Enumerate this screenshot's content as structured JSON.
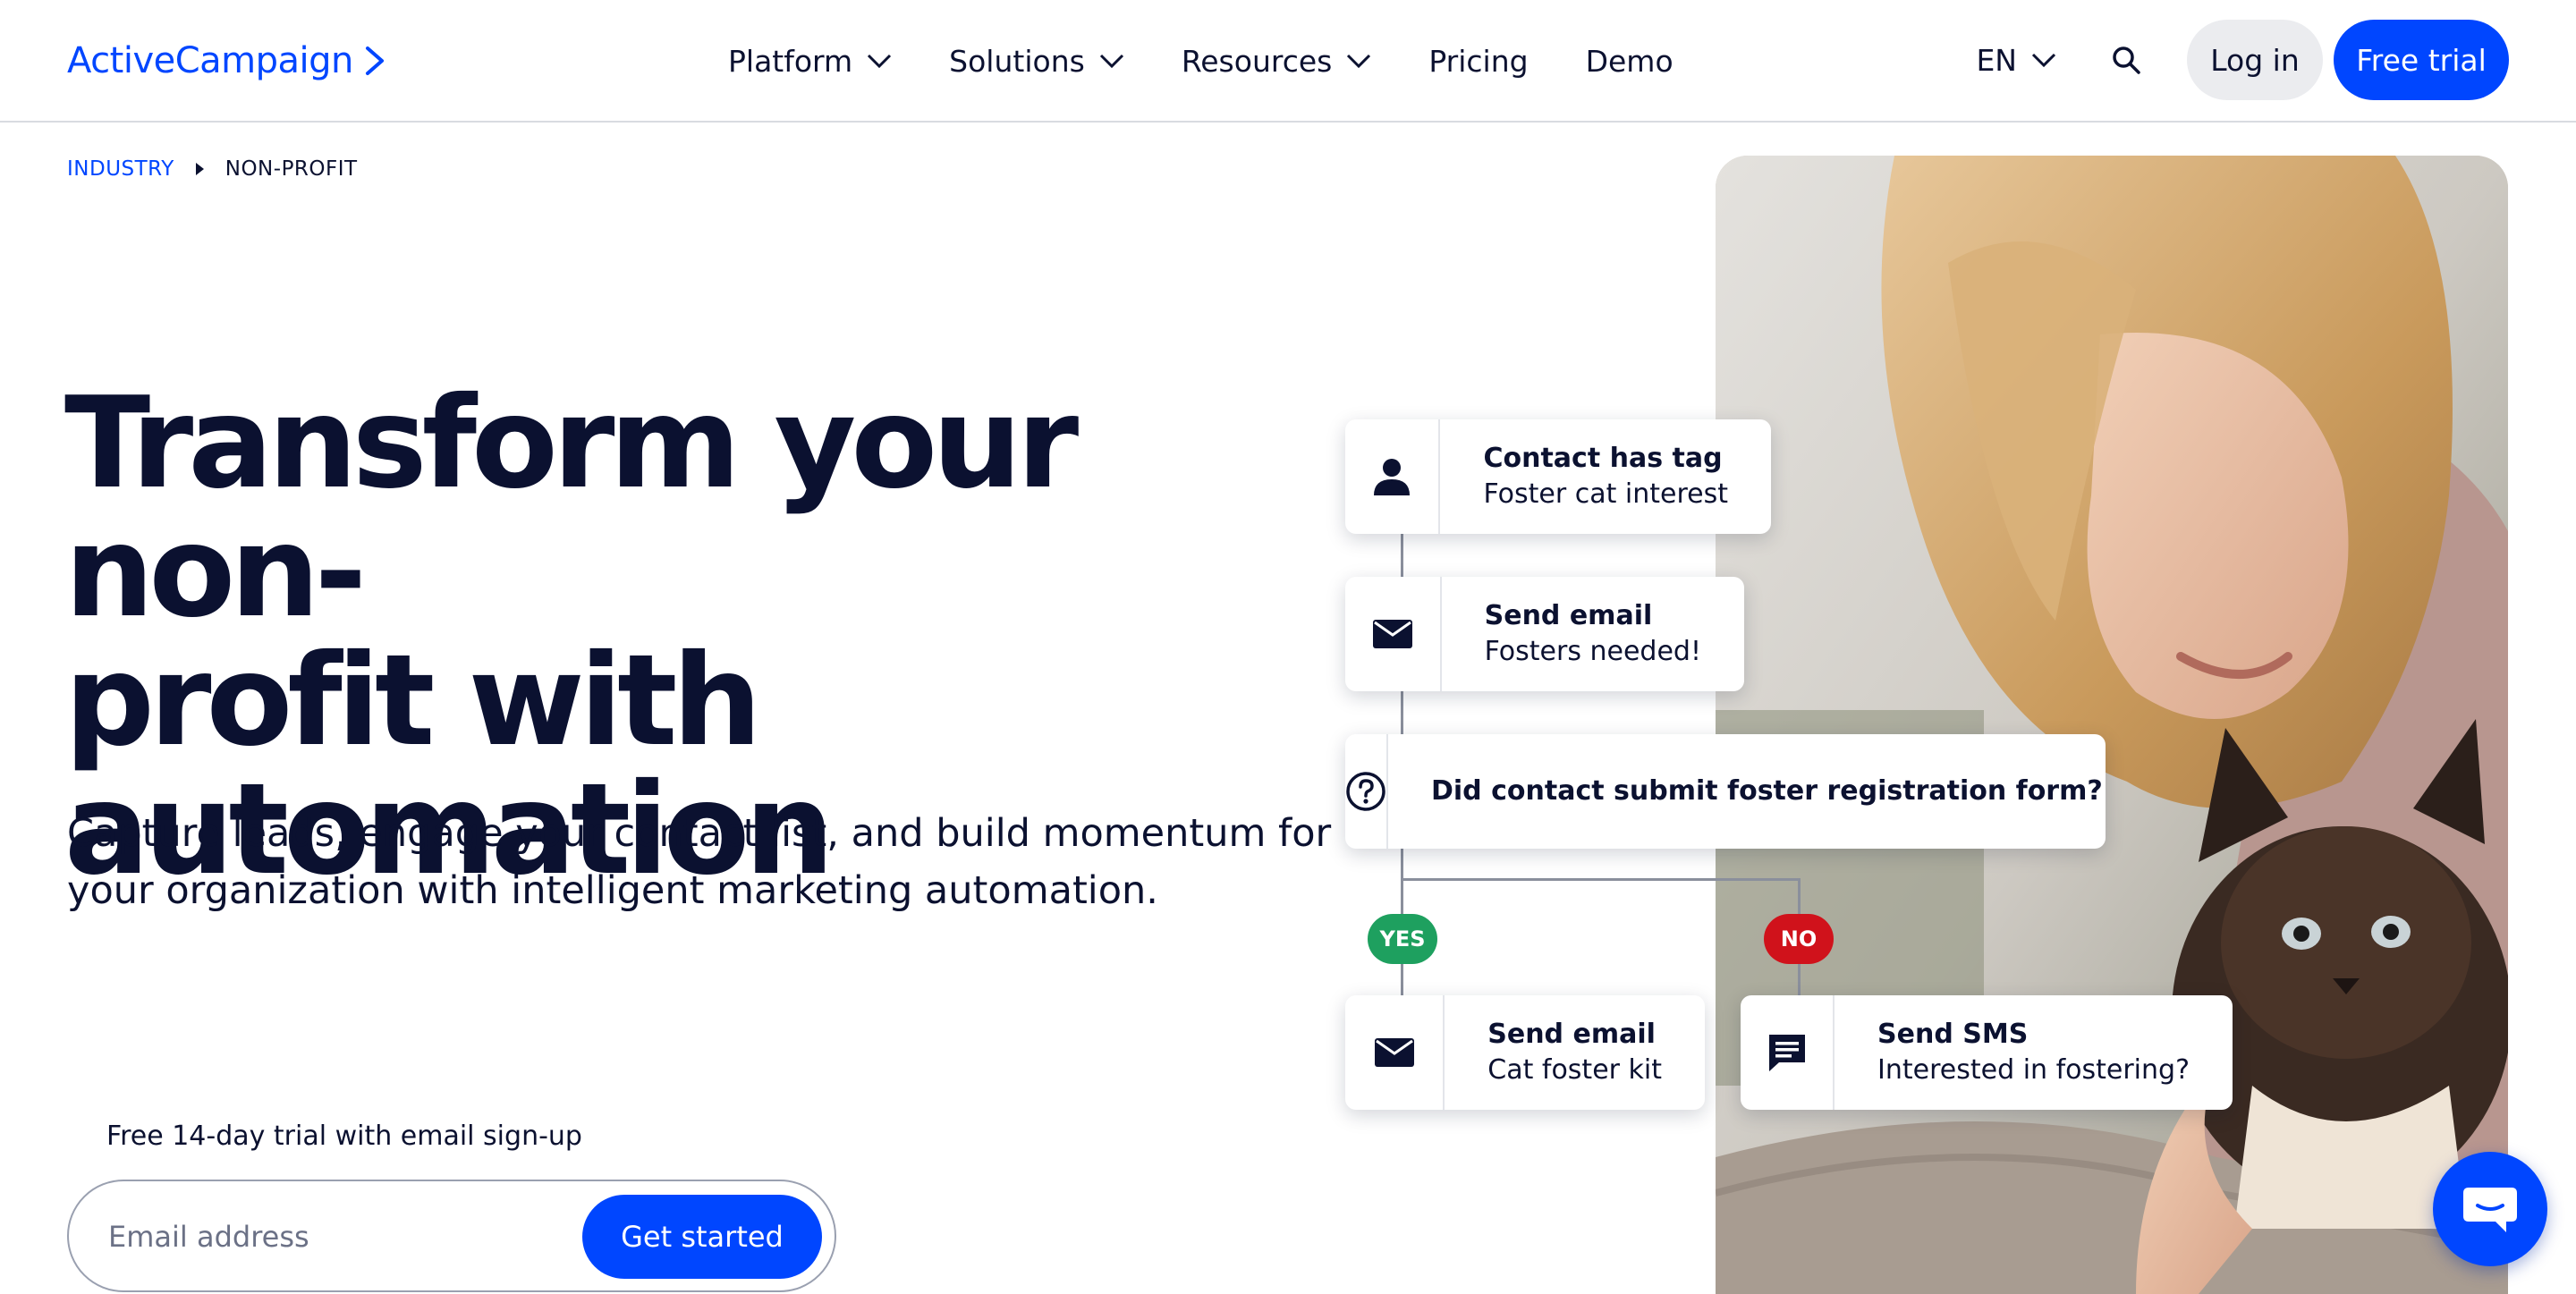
{
  "header": {
    "logo_text": "ActiveCampaign",
    "nav": [
      {
        "label": "Platform",
        "has_dropdown": true
      },
      {
        "label": "Solutions",
        "has_dropdown": true
      },
      {
        "label": "Resources",
        "has_dropdown": true
      },
      {
        "label": "Pricing",
        "has_dropdown": false
      },
      {
        "label": "Demo",
        "has_dropdown": false
      }
    ],
    "language": "EN",
    "login_label": "Log in",
    "trial_label": "Free trial"
  },
  "breadcrumb": {
    "parent": "INDUSTRY",
    "current": "NON-PROFIT"
  },
  "hero": {
    "title_line1": "Transform your non-",
    "title_line2": "profit with",
    "title_line3": "automation",
    "subtitle": "Capture leads, engage your contact list, and build momentum for your organization with intelligent marketing automation.",
    "trial_note": "Free 14-day trial with email sign-up",
    "email_placeholder": "Email address",
    "cta_label": "Get started"
  },
  "workflow": {
    "step1": {
      "title": "Contact has tag",
      "detail": "Foster cat interest",
      "icon": "person-icon"
    },
    "step2": {
      "title": "Send email",
      "detail": "Fosters needed!",
      "icon": "envelope-icon"
    },
    "step3": {
      "title": "Did contact submit foster registration form?",
      "icon": "question-icon"
    },
    "yes_label": "YES",
    "no_label": "NO",
    "step4": {
      "title": "Send email",
      "detail": "Cat foster kit",
      "icon": "envelope-icon"
    },
    "step5": {
      "title": "Send SMS",
      "detail": "Interested in fostering?",
      "icon": "sms-icon"
    }
  },
  "colors": {
    "brand_blue": "#0046ff",
    "navy_text": "#0b1130",
    "yes_green": "#1ea05f",
    "no_red": "#d0121b"
  }
}
